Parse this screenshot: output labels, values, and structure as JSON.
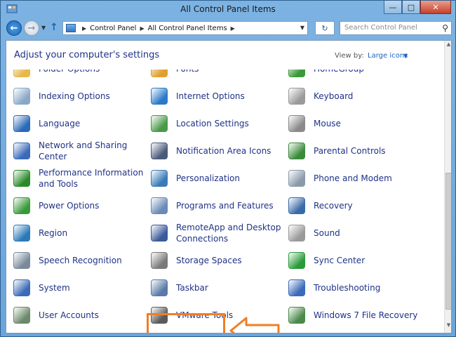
{
  "window": {
    "title": "All Control Panel Items"
  },
  "address": {
    "crumbs": [
      "Control Panel",
      "All Control Panel Items"
    ]
  },
  "search": {
    "placeholder": "Search Control Panel"
  },
  "header": {
    "heading": "Adjust your computer's settings",
    "view_by_label": "View by:",
    "view_by_value": "Large icons"
  },
  "items": [
    {
      "label": "Folder Options",
      "icon": "folder-options-icon",
      "color": "#e8b84a"
    },
    {
      "label": "Fonts",
      "icon": "fonts-icon",
      "color": "#e0a030"
    },
    {
      "label": "HomeGroup",
      "icon": "homegroup-icon",
      "color": "#3a9a3a"
    },
    {
      "label": "Indexing Options",
      "icon": "indexing-options-icon",
      "color": "#8aa8c8"
    },
    {
      "label": "Internet Options",
      "icon": "internet-options-icon",
      "color": "#2a7ac8"
    },
    {
      "label": "Keyboard",
      "icon": "keyboard-icon",
      "color": "#9a9a9a"
    },
    {
      "label": "Language",
      "icon": "language-icon",
      "color": "#2a6ab8"
    },
    {
      "label": "Location Settings",
      "icon": "location-settings-icon",
      "color": "#4a9a4a"
    },
    {
      "label": "Mouse",
      "icon": "mouse-icon",
      "color": "#8a8a8a"
    },
    {
      "label": "Network and Sharing Center",
      "icon": "network-sharing-icon",
      "color": "#3a6ab8"
    },
    {
      "label": "Notification Area Icons",
      "icon": "notification-area-icon",
      "color": "#4a5a7a"
    },
    {
      "label": "Parental Controls",
      "icon": "parental-controls-icon",
      "color": "#3a8a3a"
    },
    {
      "label": "Performance Information and Tools",
      "icon": "performance-icon",
      "color": "#2a8a2a"
    },
    {
      "label": "Personalization",
      "icon": "personalization-icon",
      "color": "#3a7ab8"
    },
    {
      "label": "Phone and Modem",
      "icon": "phone-modem-icon",
      "color": "#8a9aaa"
    },
    {
      "label": "Power Options",
      "icon": "power-options-icon",
      "color": "#3a9a3a"
    },
    {
      "label": "Programs and Features",
      "icon": "programs-features-icon",
      "color": "#6a8ab8"
    },
    {
      "label": "Recovery",
      "icon": "recovery-icon",
      "color": "#3a6aa8"
    },
    {
      "label": "Region",
      "icon": "region-icon",
      "color": "#2a7ab8"
    },
    {
      "label": "RemoteApp and Desktop Connections",
      "icon": "remoteapp-icon",
      "color": "#3a5a9a"
    },
    {
      "label": "Sound",
      "icon": "sound-icon",
      "color": "#9a9a9a"
    },
    {
      "label": "Speech Recognition",
      "icon": "speech-recognition-icon",
      "color": "#7a8a9a"
    },
    {
      "label": "Storage Spaces",
      "icon": "storage-spaces-icon",
      "color": "#7a7a7a"
    },
    {
      "label": "Sync Center",
      "icon": "sync-center-icon",
      "color": "#2a9a3a"
    },
    {
      "label": "System",
      "icon": "system-icon",
      "color": "#3a6ab8"
    },
    {
      "label": "Taskbar",
      "icon": "taskbar-icon",
      "color": "#5a7aa8"
    },
    {
      "label": "Troubleshooting",
      "icon": "troubleshooting-icon",
      "color": "#3a6ab8"
    },
    {
      "label": "User Accounts",
      "icon": "user-accounts-icon",
      "color": "#6a8a6a"
    },
    {
      "label": "VMware Tools",
      "icon": "vmware-tools-icon",
      "color": "#5a5a5a"
    },
    {
      "label": "Windows 7 File Recovery",
      "icon": "file-recovery-icon",
      "color": "#4a8a4a"
    }
  ],
  "colors": {
    "accent": "#1e3287",
    "link": "#1a64c0",
    "highlight": "#f07e26"
  }
}
